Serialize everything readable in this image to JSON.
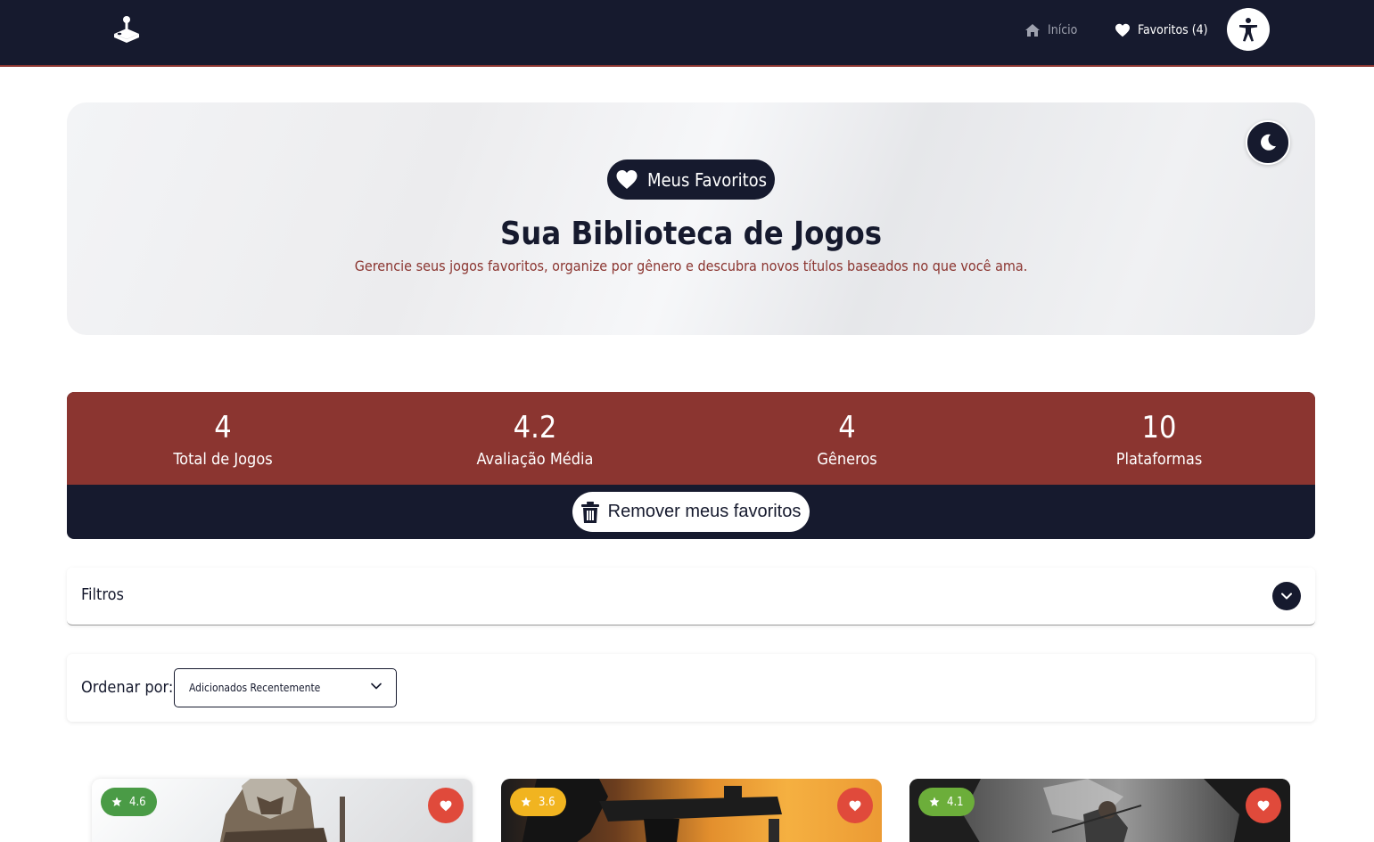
{
  "nav": {
    "logo_icon": "joystick-icon",
    "home_label": "Início",
    "favorites_label": "Favoritos (4)",
    "accessibility_icon": "accessibility-icon"
  },
  "hero": {
    "badge_label": "Meus Favoritos",
    "title": "Sua Biblioteca de Jogos",
    "subtitle": "Gerencie seus jogos favoritos, organize por gênero e descubra novos títulos baseados no que você ama.",
    "theme_icon": "moon-icon"
  },
  "stats": [
    {
      "value": "4",
      "label": "Total de Jogos"
    },
    {
      "value": "4.2",
      "label": "Avaliação Média"
    },
    {
      "value": "4",
      "label": "Gêneros"
    },
    {
      "value": "10",
      "label": "Plataformas"
    }
  ],
  "remove_button": {
    "label": "Remover meus favoritos",
    "icon": "trash-icon"
  },
  "filters": {
    "label": "Filtros",
    "icon": "chevron-down-icon"
  },
  "sort": {
    "label": "Ordenar por:",
    "selected": "Adicionados Recentemente"
  },
  "cards": [
    {
      "rating": "4.6",
      "rating_color": "#4a9b46"
    },
    {
      "rating": "3.6",
      "rating_color": "#f1b420"
    },
    {
      "rating": "4.1",
      "rating_color": "#6cae3a"
    }
  ],
  "colors": {
    "navy": "#161a2e",
    "accent_red": "#8b3530",
    "heart_red": "#e04a3b"
  }
}
